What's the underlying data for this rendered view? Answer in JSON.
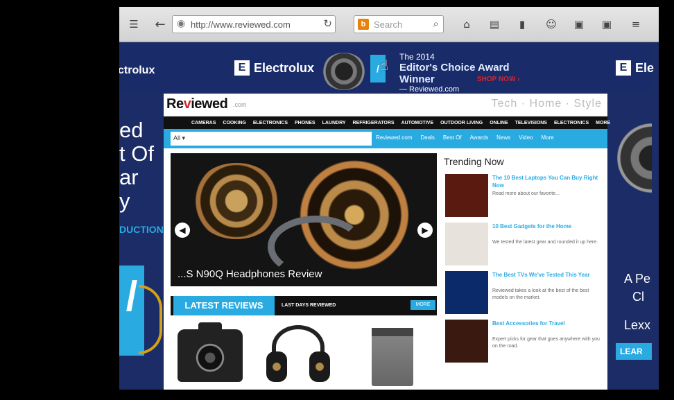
{
  "browser": {
    "url": "http://www.reviewed.com",
    "search_placeholder": "Search",
    "search_engine": "b",
    "icons": {
      "menu": "sidebar-icon",
      "back": "back-arrow-icon",
      "reload": "reload-icon",
      "search": "search-icon",
      "home": "home-icon",
      "library": "library-icon",
      "bookmark": "bookmark-icon",
      "account": "account-icon",
      "tabs": "tabs-icon",
      "overflow": "overflow-icon",
      "hamburger": "hamburger-icon"
    }
  },
  "top_ad": {
    "brand_left": "ctrolux",
    "brand_mid": "Electrolux",
    "brand_right": "Ele",
    "award_line1": "The 2014",
    "award_line2": "Editor's Choice Award Winner",
    "award_line3": "— Reviewed.com",
    "shop_button": "SHOP NOW ›"
  },
  "left_ad": {
    "lines": [
      "ed",
      "t Of",
      "ar",
      "y"
    ],
    "link": "DUCTION",
    "badge_glyph": "/"
  },
  "right_ad": {
    "line1": "A Pe",
    "line2": "Cl",
    "line3": "Lexx",
    "button": "LEAR"
  },
  "site": {
    "logo_main": "Re",
    "logo_accent": "v",
    "logo_rest": "iewed",
    "logo_tag": ".com",
    "header_right": "Tech · Home · Style",
    "nav": [
      "CAMERAS",
      "COOKING",
      "ELECTRONICS",
      "PHONES",
      "LAUNDRY",
      "REFRIGERATORS",
      "AUTOMOTIVE",
      "OUTDOOR LIVING",
      "ONLINE",
      "TELEVISIONS",
      "ELECTRONICS",
      "MORE"
    ],
    "subnav_search": "All ▾",
    "subnav_links": [
      "Reviewed.com",
      "Deals",
      "Best Of",
      "Awards",
      "News",
      "Video",
      "More"
    ],
    "hero_caption": "...S N90Q Headphones Review",
    "latest_tab": "LATEST REVIEWS",
    "latest_sub": "LAST DAYS REVIEWED",
    "latest_btn": "MORE",
    "trending_title": "Trending Now",
    "trending": [
      {
        "headline": "The 10 Best Laptops You Can Buy Right Now",
        "snippet": "Read more about our favorite...",
        "thumb_color": "#5a1a10"
      },
      {
        "headline": "10 Best Gadgets for the Home",
        "snippet": "We tested the latest gear and rounded it up here.",
        "thumb_color": "#e8e2dc"
      },
      {
        "headline": "The Best TVs We've Tested This Year",
        "snippet": "Reviewed takes a look at the best of the best models on the market.",
        "thumb_color": "#0a2a6a"
      },
      {
        "headline": "Best Accessories for Travel",
        "snippet": "Expert picks for gear that goes anywhere with you on the road.",
        "thumb_color": "#3a1a10"
      }
    ]
  }
}
